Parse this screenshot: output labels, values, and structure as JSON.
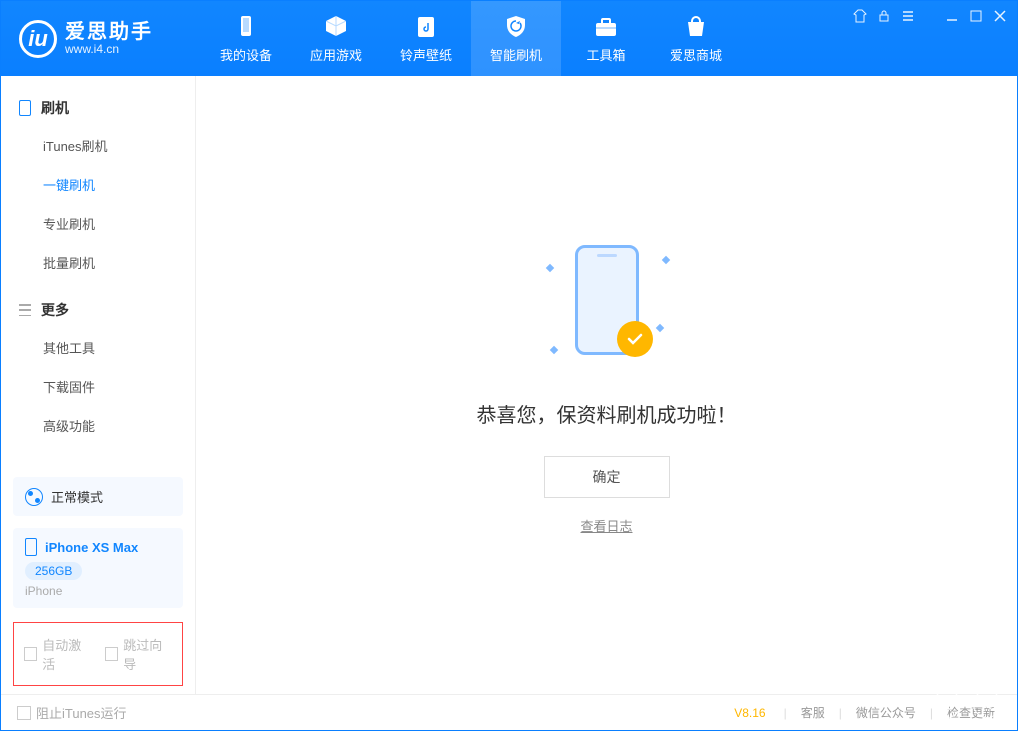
{
  "app": {
    "name": "爱思助手",
    "url": "www.i4.cn"
  },
  "nav": [
    {
      "label": "我的设备"
    },
    {
      "label": "应用游戏"
    },
    {
      "label": "铃声壁纸"
    },
    {
      "label": "智能刷机"
    },
    {
      "label": "工具箱"
    },
    {
      "label": "爱思商城"
    }
  ],
  "sidebar": {
    "section1": {
      "title": "刷机",
      "items": [
        "iTunes刷机",
        "一键刷机",
        "专业刷机",
        "批量刷机"
      ]
    },
    "section2": {
      "title": "更多",
      "items": [
        "其他工具",
        "下载固件",
        "高级功能"
      ]
    }
  },
  "mode": {
    "label": "正常模式"
  },
  "device": {
    "name": "iPhone XS Max",
    "capacity": "256GB",
    "type": "iPhone"
  },
  "options": {
    "auto_activate": "自动激活",
    "skip_guide": "跳过向导"
  },
  "main": {
    "success": "恭喜您，保资料刷机成功啦！",
    "ok": "确定",
    "log": "查看日志"
  },
  "footer": {
    "block_itunes": "阻止iTunes运行",
    "version": "V8.16",
    "links": [
      "客服",
      "微信公众号",
      "检查更新"
    ]
  }
}
